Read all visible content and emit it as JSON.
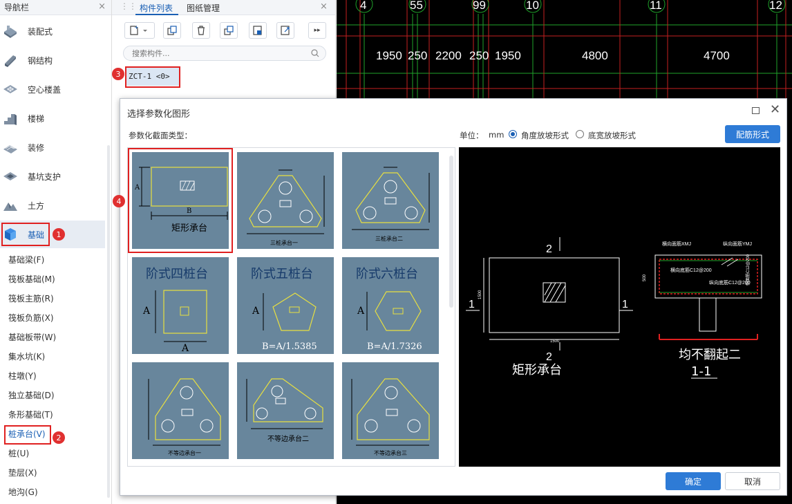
{
  "nav": {
    "title": "导航栏",
    "close": "×",
    "categories": [
      {
        "label": "装配式",
        "icon": "prefab-icon"
      },
      {
        "label": "钢结构",
        "icon": "steel-structure-icon"
      },
      {
        "label": "空心楼盖",
        "icon": "hollow-floor-icon"
      },
      {
        "label": "楼梯",
        "icon": "stairs-icon"
      },
      {
        "label": "装修",
        "icon": "decoration-icon"
      },
      {
        "label": "基坑支护",
        "icon": "pit-support-icon"
      },
      {
        "label": "土方",
        "icon": "earthwork-icon"
      },
      {
        "label": "基础",
        "icon": "foundation-icon"
      }
    ],
    "items": [
      "基础梁(F)",
      "筏板基础(M)",
      "筏板主筋(R)",
      "筏板负筋(X)",
      "基础板带(W)",
      "集水坑(K)",
      "柱墩(Y)",
      "独立基础(D)",
      "条形基础(T)",
      "桩承台(V)",
      "桩(U)",
      "垫层(X)",
      "地沟(G)"
    ],
    "selected_category": "基础",
    "selected_item": "桩承台(V)"
  },
  "badges": [
    "1",
    "2",
    "3",
    "4"
  ],
  "component_panel": {
    "tabs": [
      "构件列表",
      "图纸管理"
    ],
    "close": "×",
    "search_placeholder": "搜索构件...",
    "items": [
      "ZCT-1 <0>"
    ]
  },
  "cad": {
    "axis_numbers": [
      "4",
      "55",
      "99",
      "10",
      "11",
      "12"
    ],
    "dimensions": [
      "1950",
      "250",
      "2200",
      "250",
      "1950",
      "4800",
      "4700"
    ]
  },
  "dialog": {
    "title": "选择参数化图形",
    "section_label": "参数化截面类型：",
    "unit_label": "单位：",
    "unit_value": "mm",
    "radio_options": [
      "角度放坡形式",
      "底宽放坡形式"
    ],
    "selected_radio": "角度放坡形式",
    "rebar_button": "配筋形式",
    "ok_button": "确定",
    "cancel_button": "取消",
    "shapes": [
      {
        "name": "矩形承台",
        "labels": [
          "A",
          "B"
        ]
      },
      {
        "name": "三桩承台一"
      },
      {
        "name": "三桩承台二"
      },
      {
        "name": "阶式四桩台",
        "labels": [
          "A",
          "A"
        ]
      },
      {
        "name": "阶式五桩台",
        "labels": [
          "A",
          "B=A/1.5385"
        ]
      },
      {
        "name": "阶式六桩台",
        "labels": [
          "A",
          "B=A/1.7326"
        ]
      },
      {
        "name": "不等边承台一"
      },
      {
        "name": "不等边承台二"
      },
      {
        "name": "不等边承台三"
      }
    ],
    "preview": {
      "plan_label": "矩形承台",
      "section_label_top": "2",
      "section_label_bottom": "2",
      "side_left": "1",
      "side_right": "1",
      "dim_plan_w": "1500",
      "dim_plan_h": "1500",
      "dim_section_h": "500",
      "rebar_top_x": "横向面筋XMJ",
      "rebar_top_y": "纵向面筋YMJ",
      "rebar_bottom_x": "横向底筋C12@200",
      "rebar_bottom_y": "纵向底筋C12@200",
      "side_rebar": "侧面筋C12@200",
      "hook_note": "均不翻起二",
      "section_name": "1-1"
    }
  },
  "colors": {
    "accent": "#1a5fb4",
    "badge": "#e03030",
    "cell_bg": "#68869c",
    "shape_line": "#e8e040"
  }
}
